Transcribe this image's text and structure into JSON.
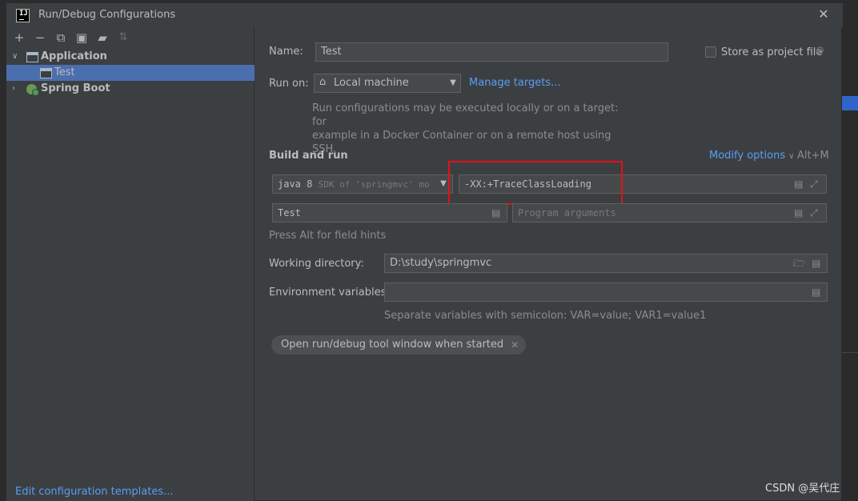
{
  "window": {
    "title": "Run/Debug Configurations",
    "close_glyph": "✕",
    "logo_text": "IJ"
  },
  "toolbar": {
    "add_glyph": "+",
    "remove_glyph": "−",
    "copy_glyph": "⧉",
    "save_glyph": "▣",
    "folder_glyph": "▰",
    "sort_glyph": "⇅"
  },
  "tree": {
    "items": [
      {
        "label": "Application",
        "expanded": true,
        "icon": "application-config-icon"
      },
      {
        "label": "Test",
        "selected": true,
        "icon": "application-config-icon"
      },
      {
        "label": "Spring Boot",
        "expanded": false,
        "icon": "spring-boot-icon"
      }
    ]
  },
  "edit_templates_link": "Edit configuration templates...",
  "form": {
    "name_label": "Name:",
    "name_value": "Test",
    "store_label": "Store as project file",
    "store_checked": false,
    "run_on_label": "Run on:",
    "run_on_value": "Local machine",
    "manage_targets": "Manage targets...",
    "run_on_desc_line1": "Run configurations may be executed locally or on a target: for",
    "run_on_desc_line2": "example in a Docker Container or on a remote host using SSH.",
    "build_run_title": "Build and run",
    "modify_options": "Modify options",
    "modify_options_shortcut": "Alt+M",
    "jdk_value": "java 8",
    "jdk_hint": "SDK of 'springmvc' mo",
    "vm_options_value": "-XX:+TraceClassLoading",
    "main_class_value": "Test",
    "program_args_placeholder": "Program arguments",
    "alt_hint": "Press Alt for field hints",
    "working_dir_label": "Working directory:",
    "working_dir_value": "D:\\study\\springmvc",
    "env_vars_label": "Environment variables:",
    "env_vars_value": "",
    "env_vars_hint": "Separate variables with semicolon: VAR=value; VAR1=value1",
    "chip_label": "Open run/debug tool window when started",
    "chip_close": "✕"
  },
  "watermark": "CSDN @吴代庄",
  "colors": {
    "background": "#3c3f41",
    "selection": "#4b6eaf",
    "link": "#589df6",
    "highlight_box": "#e5101a"
  }
}
